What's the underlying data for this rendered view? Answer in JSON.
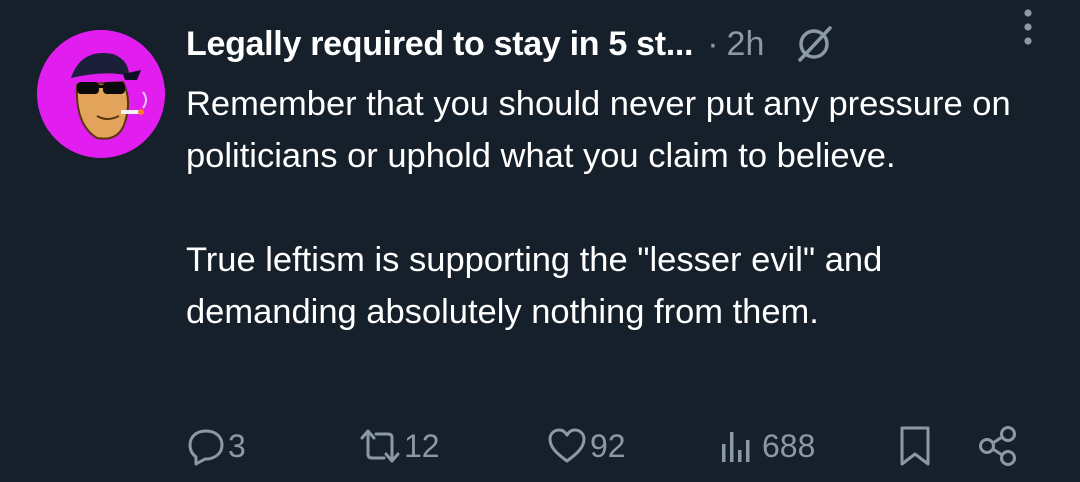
{
  "post": {
    "author_name": "Legally required to stay in 5 st...",
    "separator": "·",
    "time": "2h",
    "paragraph_1": "Remember that you should never put any pressure on politicians or uphold what you claim to believe.",
    "paragraph_2": "True leftism is supporting the \"lesser evil\" and demanding absolutely nothing from them."
  },
  "actions": {
    "replies": "3",
    "reposts": "12",
    "likes": "92",
    "views": "688"
  },
  "colors": {
    "background": "#15202b",
    "text": "#ffffff",
    "muted": "#8b98a5",
    "avatar_bg": "#e11df0"
  },
  "icons": [
    "avatar",
    "grok-icon",
    "more-icon",
    "reply-icon",
    "repost-icon",
    "like-icon",
    "views-icon",
    "bookmark-icon",
    "share-icon"
  ]
}
